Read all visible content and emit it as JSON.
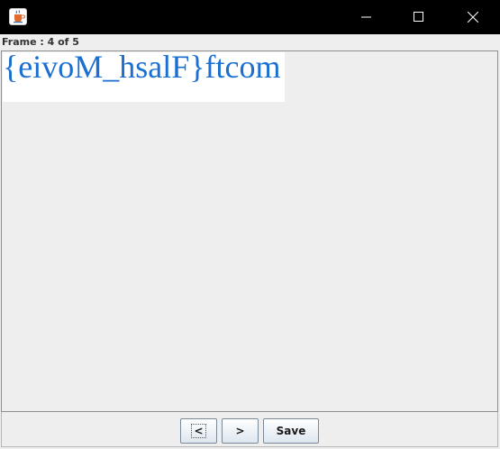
{
  "window": {
    "title": ""
  },
  "icons": {
    "app": "java-cup-icon",
    "minimize": "minimize-icon",
    "maximize": "maximize-icon",
    "close": "close-icon"
  },
  "frame_label": "Frame : 4 of 5",
  "image_text": "{eivoM_hsalF}ftcom",
  "colors": {
    "image_text": "#1a6fd0",
    "titlebar": "#000000",
    "background": "#eeeeee"
  },
  "buttons": {
    "prev": "<",
    "next": ">",
    "save": "Save"
  }
}
